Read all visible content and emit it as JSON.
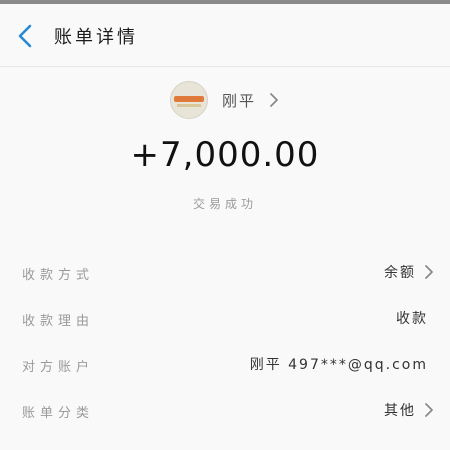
{
  "header": {
    "title": "账单详情"
  },
  "merchant": {
    "name": "刚平"
  },
  "transaction": {
    "amount": "+7,000.00",
    "status": "交易成功"
  },
  "details": [
    {
      "label": "收款方式",
      "value": "余额"
    },
    {
      "label": "收款理由",
      "value": "收款"
    },
    {
      "label": "对方账户",
      "value": "刚平 497***@qq.com"
    },
    {
      "label": "账单分类",
      "value": "其他"
    }
  ],
  "colors": {
    "back_icon": "#2a8ad0",
    "chevron": "#8a8a8a"
  },
  "icons": {
    "back": "chevron-left-icon",
    "avatar": "merchant-avatar",
    "next": "chevron-right-icon"
  }
}
